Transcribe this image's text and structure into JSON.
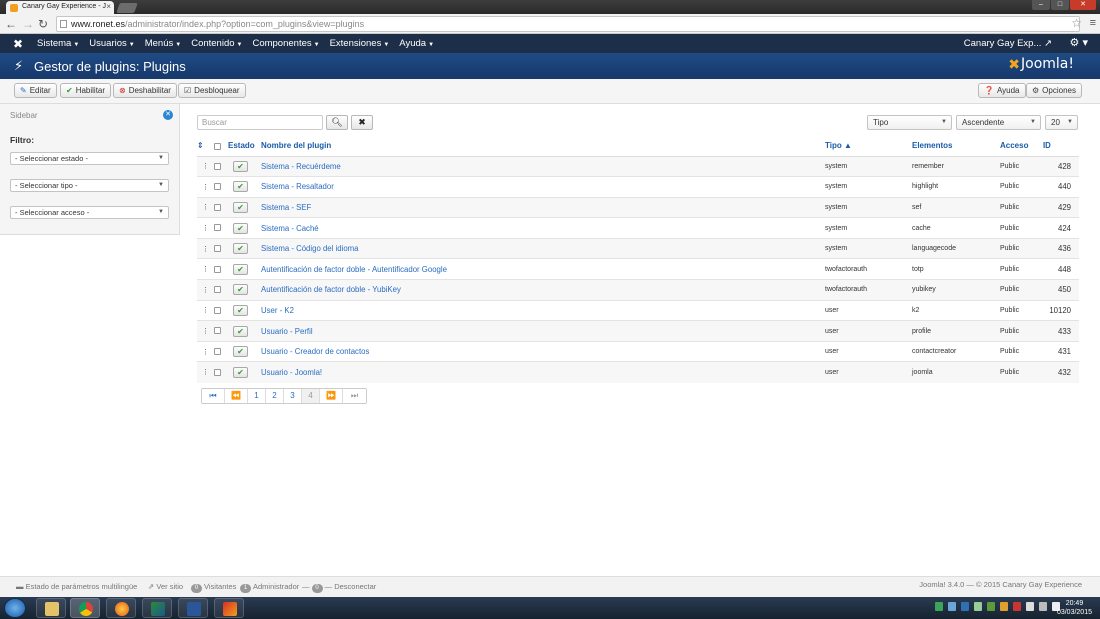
{
  "browser": {
    "tab_title": "Canary Gay Experience - J",
    "url_host": "www.ronet.es",
    "url_path": "/administrator/index.php?option=com_plugins&view=plugins"
  },
  "topnav": {
    "menus": [
      "Sistema",
      "Usuarios",
      "Menús",
      "Contenido",
      "Componentes",
      "Extensiones",
      "Ayuda"
    ],
    "site_name": "Canary Gay Exp..."
  },
  "header": {
    "title": "Gestor de plugins: Plugins",
    "brand": "Joomla!"
  },
  "toolbar": {
    "edit": "Editar",
    "enable": "Habilitar",
    "disable": "Deshabilitar",
    "checkin": "Desbloquear",
    "help": "Ayuda",
    "options": "Opciones"
  },
  "sidebar": {
    "title": "Sidebar",
    "filter_label": "Filtro:",
    "state_select": "- Seleccionar estado -",
    "type_select": "- Seleccionar tipo -",
    "access_select": "- Seleccionar acceso -"
  },
  "search": {
    "placeholder": "Buscar",
    "sort_field": "Tipo",
    "sort_dir": "Ascendente",
    "limit": "20"
  },
  "table": {
    "headers": {
      "state": "Estado",
      "name": "Nombre del plugin",
      "type": "Tipo",
      "elements": "Elementos",
      "access": "Acceso",
      "id": "ID"
    },
    "rows": [
      {
        "name": "Sistema - Recuérdeme",
        "type": "system",
        "element": "remember",
        "access": "Public",
        "id": "428"
      },
      {
        "name": "Sistema - Resaltador",
        "type": "system",
        "element": "highlight",
        "access": "Public",
        "id": "440"
      },
      {
        "name": "Sistema - SEF",
        "type": "system",
        "element": "sef",
        "access": "Public",
        "id": "429"
      },
      {
        "name": "Sistema - Caché",
        "type": "system",
        "element": "cache",
        "access": "Public",
        "id": "424"
      },
      {
        "name": "Sistema - Código del idioma",
        "type": "system",
        "element": "languagecode",
        "access": "Public",
        "id": "436"
      },
      {
        "name": "Autentificación de factor doble - Autentificador Google",
        "type": "twofactorauth",
        "element": "totp",
        "access": "Public",
        "id": "448"
      },
      {
        "name": "Autentificación de factor doble - YubiKey",
        "type": "twofactorauth",
        "element": "yubikey",
        "access": "Public",
        "id": "450"
      },
      {
        "name": "User - K2",
        "type": "user",
        "element": "k2",
        "access": "Public",
        "id": "10120"
      },
      {
        "name": "Usuario - Perfil",
        "type": "user",
        "element": "profile",
        "access": "Public",
        "id": "433"
      },
      {
        "name": "Usuario - Creador de contactos",
        "type": "user",
        "element": "contactcreator",
        "access": "Public",
        "id": "431"
      },
      {
        "name": "Usuario - Joomla!",
        "type": "user",
        "element": "joomla",
        "access": "Public",
        "id": "432"
      }
    ]
  },
  "pagination": {
    "pages": [
      "1",
      "2",
      "3",
      "4"
    ],
    "current": "4"
  },
  "statusbar": {
    "multilang": "Estado de parámetros multilingüe",
    "view_site": "Ver sitio",
    "visitors_count": "0",
    "visitors_label": "Visitantes",
    "admin_count": "1",
    "admin_label": "Administrador",
    "logout_count": "0",
    "logout_label": "Desconectar",
    "footer": "Joomla! 3.4.0 — © 2015 Canary Gay Experience"
  },
  "taskbar": {
    "time": "20:49",
    "date": "03/03/2015"
  }
}
